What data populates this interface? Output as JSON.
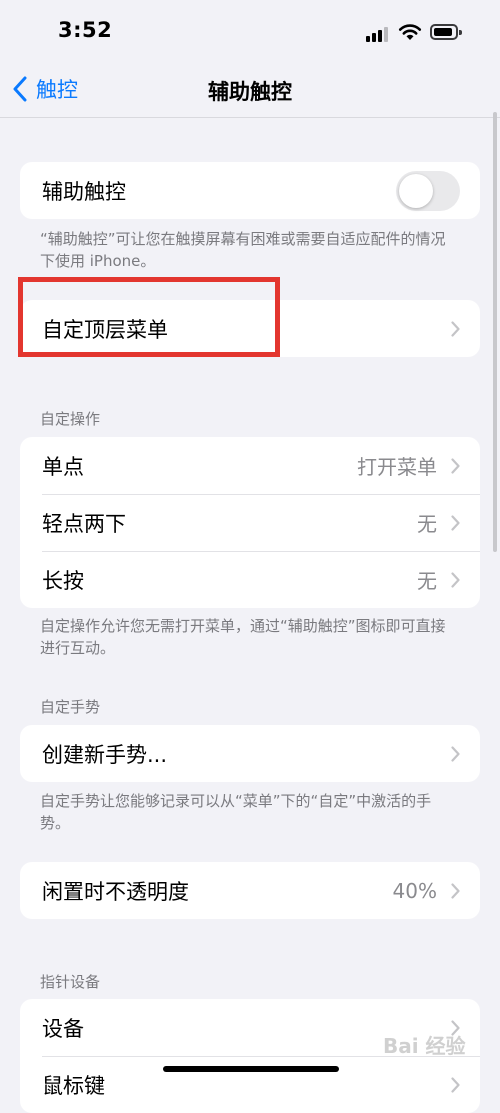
{
  "status_bar": {
    "time": "3:52"
  },
  "nav": {
    "back_label": "触控",
    "title": "辅助触控"
  },
  "assistive_touch": {
    "label": "辅助触控",
    "toggle_on": false,
    "footer": "“辅助触控”可让您在触摸屏幕有困难或需要自适应配件的情况下使用 iPhone。"
  },
  "top_menu": {
    "label": "自定顶层菜单"
  },
  "custom_actions": {
    "header": "自定操作",
    "items": [
      {
        "label": "单点",
        "value": "打开菜单"
      },
      {
        "label": "轻点两下",
        "value": "无"
      },
      {
        "label": "长按",
        "value": "无"
      }
    ],
    "footer": "自定操作允许您无需打开菜单，通过“辅助触控”图标即可直接进行互动。"
  },
  "custom_gestures": {
    "header": "自定手势",
    "create_label": "创建新手势...",
    "footer": "自定手势让您能够记录可以从“菜单”下的“自定”中激活的手势。"
  },
  "idle_opacity": {
    "label": "闲置时不透明度",
    "value": "40%"
  },
  "pointer_devices": {
    "header": "指针设备",
    "items": [
      {
        "label": "设备"
      },
      {
        "label": "鼠标键"
      }
    ]
  },
  "watermark": "Bai 经验",
  "colors": {
    "accent": "#0a7aff",
    "highlight": "#e3362f",
    "background": "#f2f2f7"
  }
}
